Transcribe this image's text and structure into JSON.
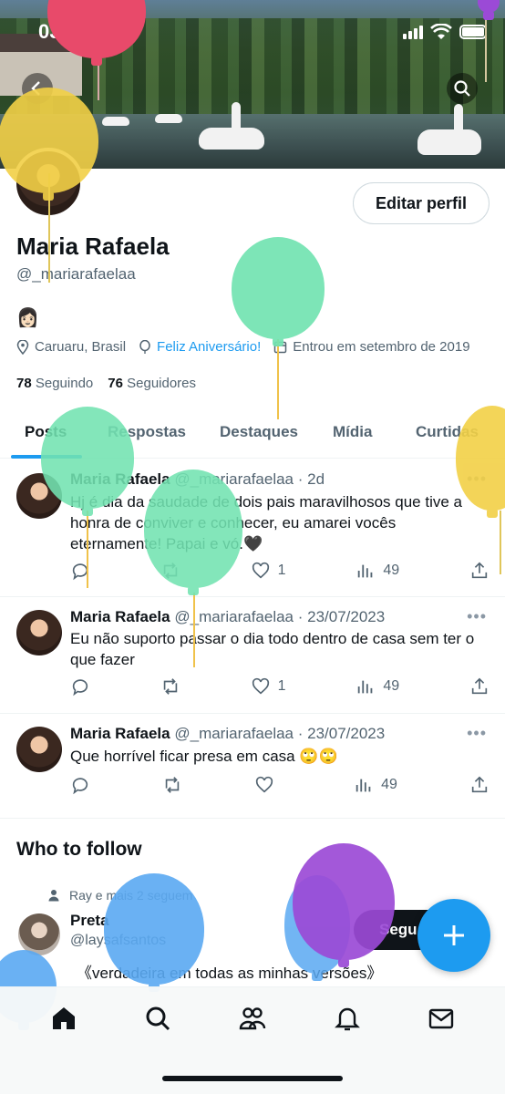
{
  "status_bar": {
    "time": "03:52"
  },
  "profile": {
    "name": "Maria Rafaela",
    "handle": "@_mariarafaelaa",
    "bio_emoji": "👩🏻",
    "location": "Caruaru, Brasil",
    "birthday_text": "Feliz Aniversário!",
    "joined": "Entrou em setembro de 2019",
    "following_count": "78",
    "following_label": "Seguindo",
    "followers_count": "76",
    "followers_label": "Seguidores",
    "edit_button": "Editar perfil"
  },
  "tabs": [
    "Posts",
    "Respostas",
    "Destaques",
    "Mídia",
    "Curtidas"
  ],
  "posts": [
    {
      "author": "Maria Rafaela",
      "handle": "@_mariarafaelaa",
      "time": "· 2d",
      "text": "Hj é dia da saudade de dois pais maravilhosos que tive a honra de conviver e conhecer, eu amarei vocês eternamente! Papai e vó.🖤",
      "likes": "1",
      "views": "49"
    },
    {
      "author": "Maria Rafaela",
      "handle": "@_mariarafaelaa",
      "time": "· 23/07/2023",
      "text": "Eu não suporto passar o dia todo dentro de casa sem ter o que fazer",
      "likes": "1",
      "views": "49"
    },
    {
      "author": "Maria Rafaela",
      "handle": "@_mariarafaelaa",
      "time": "· 23/07/2023",
      "text": "Que horrível ficar presa em casa 🙄🙄",
      "likes": "",
      "views": "49"
    }
  ],
  "who_to_follow": {
    "title": "Who to follow",
    "context": "Ray e mais 2 seguem",
    "name": "Preta",
    "handle": "@laysafsantos",
    "bio": "《verdadeira em todas as minhas versões》",
    "button": "Segu"
  },
  "icons": {
    "back": "back-arrow-icon",
    "search": "search-icon",
    "fab": "compose-plus-icon",
    "nav": [
      "home-icon",
      "search-icon",
      "communities-icon",
      "notifications-icon",
      "messages-icon"
    ]
  },
  "colors": {
    "accent": "#1d9bf0",
    "text": "#0f1419",
    "muted": "#536471",
    "balloon_yellow": "#f2d046",
    "balloon_green": "#72e3b1",
    "balloon_blue": "#5aa9f2",
    "balloon_purple": "#9b4ad6",
    "balloon_red": "#e84a6a"
  }
}
